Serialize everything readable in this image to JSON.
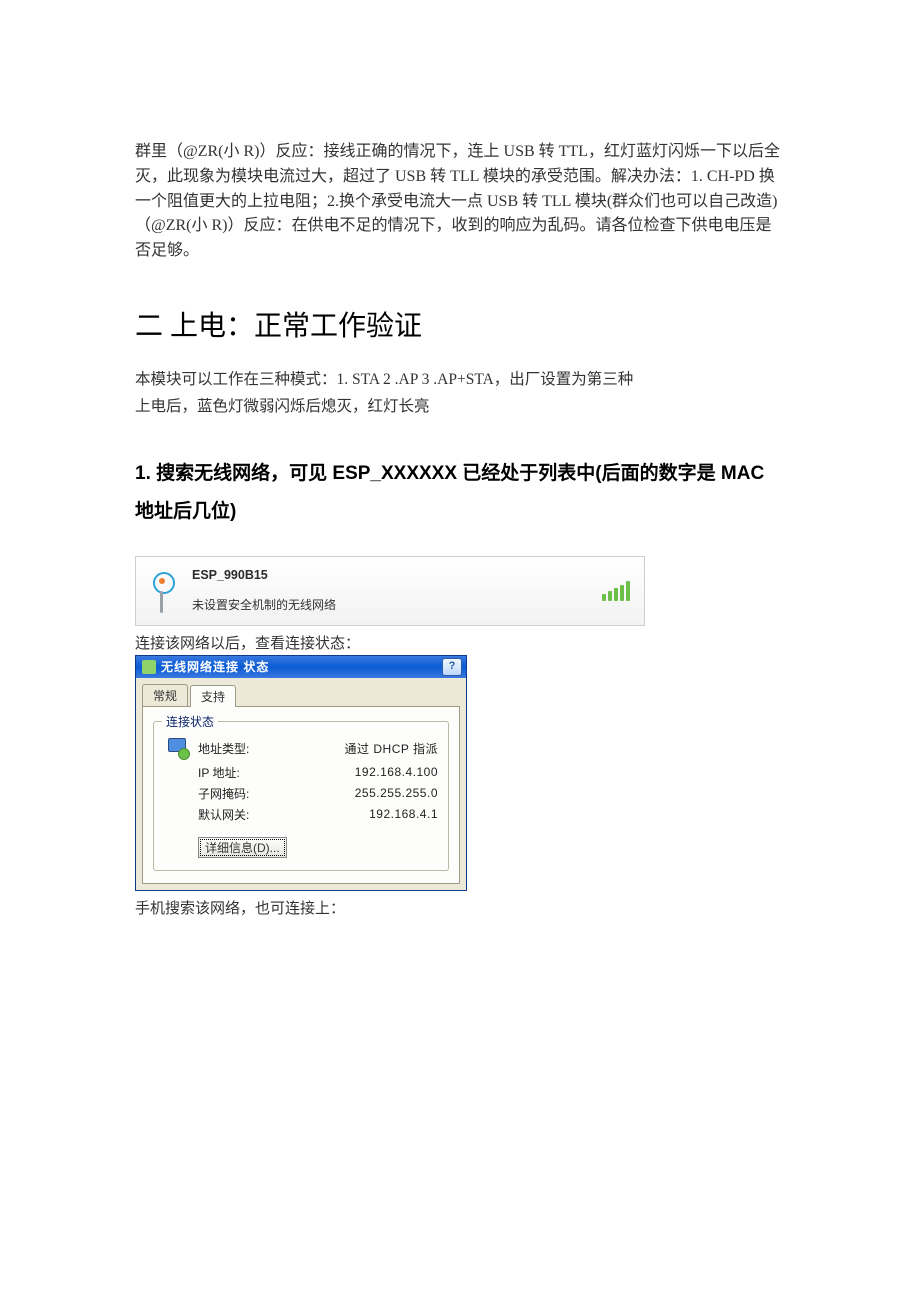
{
  "intro": {
    "p1": "群里（@ZR(小 R)）反应：接线正确的情况下，连上 USB 转 TTL，红灯蓝灯闪烁一下以后全灭，此现象为模块电流过大，超过了 USB 转 TLL 模块的承受范围。解决办法：1. CH-PD 换一个阻值更大的上拉电阻；2.换个承受电流大一点 USB 转 TLL 模块(群众们也可以自己改造) （@ZR(小 R)）反应：在供电不足的情况下，收到的响应为乱码。请各位检查下供电电压是否足够。"
  },
  "h1": "二 上电：正常工作验证",
  "modes": {
    "l1": "本模块可以工作在三种模式：1. STA   2 .AP   3 .AP+STA，出厂设置为第三种",
    "l2": "上电后，蓝色灯微弱闪烁后熄灭，红灯长亮"
  },
  "h2": "1. 搜索无线网络，可见 ESP_XXXXXX 已经处于列表中(后面的数字是 MAC 地址后几位)",
  "wifi": {
    "ssid": "ESP_990B15",
    "security": "未设置安全机制的无线网络"
  },
  "after_wifi": "连接该网络以后，查看连接状态：",
  "dialog": {
    "title": "无线网络连接 状态",
    "help": "?",
    "tab_general": "常规",
    "tab_support": "支持",
    "group_label": "连接状态",
    "addr_type_label": "地址类型:",
    "addr_type_value": "通过 DHCP 指派",
    "ip_label": "IP 地址:",
    "ip_value": "192.168.4.100",
    "mask_label": "子网掩码:",
    "mask_value": "255.255.255.0",
    "gw_label": "默认网关:",
    "gw_value": "192.168.4.1",
    "details_button": "详细信息(D)..."
  },
  "after_dialog": "手机搜索该网络，也可连接上："
}
